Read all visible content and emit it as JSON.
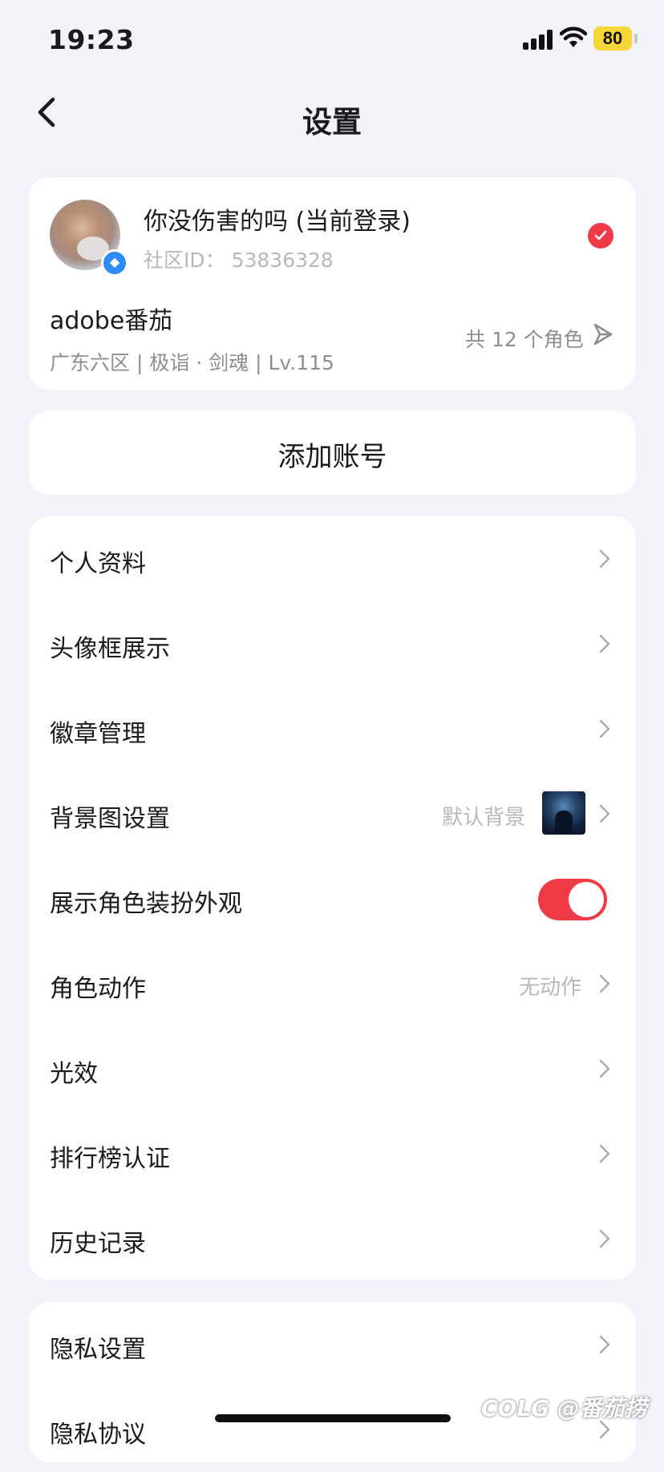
{
  "status_bar": {
    "time": "19:23",
    "battery": "80"
  },
  "nav": {
    "title": "设置"
  },
  "account": {
    "name": "你没伤害的吗 (当前登录)",
    "community_id": "社区ID：  53836328",
    "role_name": "adobe番茄",
    "role_info": "广东六区 | 极诣 · 剑魂 | Lv.115",
    "role_count": "共 12 个角色"
  },
  "add_account": {
    "label": "添加账号"
  },
  "settings": [
    {
      "label": "个人资料"
    },
    {
      "label": "头像框展示"
    },
    {
      "label": "徽章管理"
    },
    {
      "label": "背景图设置",
      "value": "默认背景"
    },
    {
      "label": "展示角色装扮外观",
      "toggle": true
    },
    {
      "label": "角色动作",
      "value": "无动作"
    },
    {
      "label": "光效"
    },
    {
      "label": "排行榜认证"
    },
    {
      "label": "历史记录"
    }
  ],
  "settings2": [
    {
      "label": "隐私设置"
    },
    {
      "label": "隐私协议"
    }
  ],
  "watermark": "COLG @番茄捞",
  "colors": {
    "accent": "#ef3a48",
    "background": "#f1f3f9",
    "card": "#ffffff"
  }
}
